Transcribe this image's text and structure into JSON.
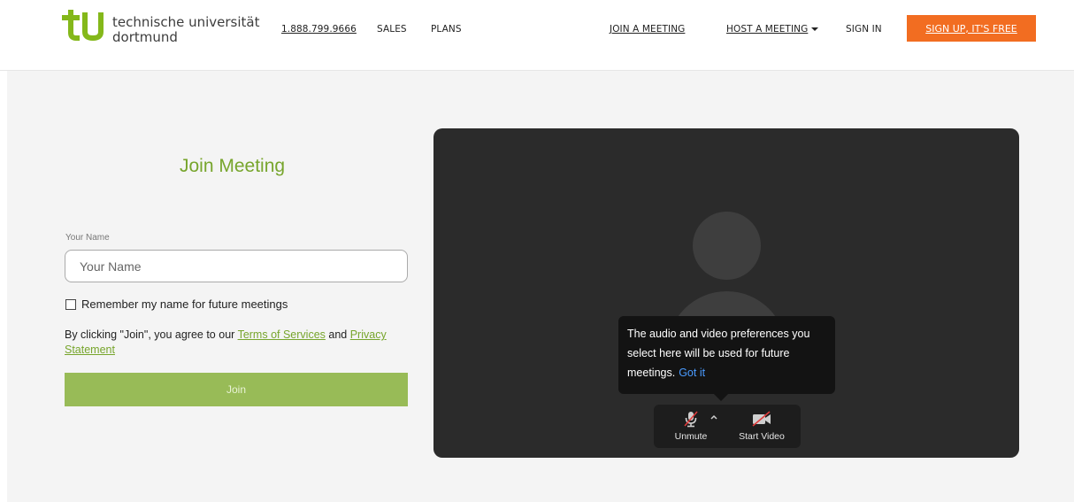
{
  "header": {
    "logo_line1": "technische universität",
    "logo_line2": "dortmund",
    "phone": "1.888.799.9666",
    "sales": "SALES",
    "plans": "PLANS",
    "join_meeting": "JOIN A MEETING",
    "host_meeting": "HOST A MEETING",
    "sign_in": "SIGN IN",
    "sign_up": "SIGN UP, IT'S FREE"
  },
  "form": {
    "title": "Join Meeting",
    "name_label": "Your Name",
    "name_placeholder": "Your Name",
    "name_value": "",
    "remember_label": "Remember my name for future meetings",
    "remember_checked": false,
    "terms_prefix": "By clicking \"Join\", you agree to our ",
    "terms_link": "Terms of Services",
    "terms_and": " and ",
    "privacy_link": "Privacy Statement",
    "join_label": "Join"
  },
  "preview": {
    "tooltip_text": "The audio and video preferences you select here will be used for future meetings.",
    "tooltip_action": "Got it",
    "unmute_label": "Unmute",
    "start_video_label": "Start Video"
  },
  "colors": {
    "brand_green": "#77a52c",
    "join_button": "#98bb57",
    "signup_orange": "#f26d21",
    "preview_bg": "#2b2b2b",
    "link_blue": "#4a9bff"
  },
  "icons": [
    "tu-logo-icon",
    "caret-down-icon",
    "muted-microphone-icon",
    "chevron-up-icon",
    "video-off-icon"
  ]
}
